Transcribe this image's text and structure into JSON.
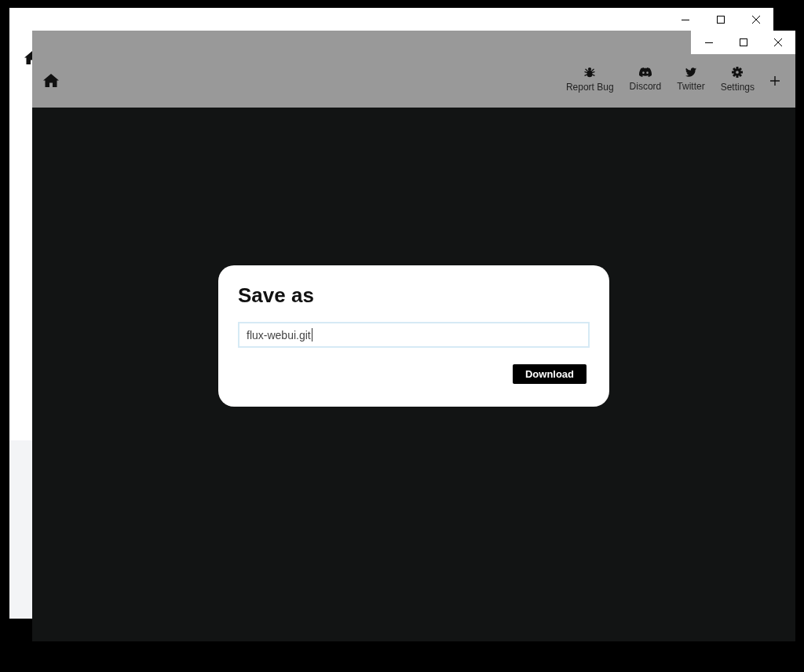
{
  "toolbar": {
    "items": [
      {
        "kind": "bug",
        "label": "Report Bug"
      },
      {
        "kind": "discord",
        "label": "Discord"
      },
      {
        "kind": "twitter",
        "label": "Twitter"
      },
      {
        "kind": "settings",
        "label": "Settings"
      }
    ]
  },
  "dialog": {
    "title": "Save as",
    "field": {
      "value": "flux-webui.git",
      "focused": true
    },
    "button": "Download"
  }
}
